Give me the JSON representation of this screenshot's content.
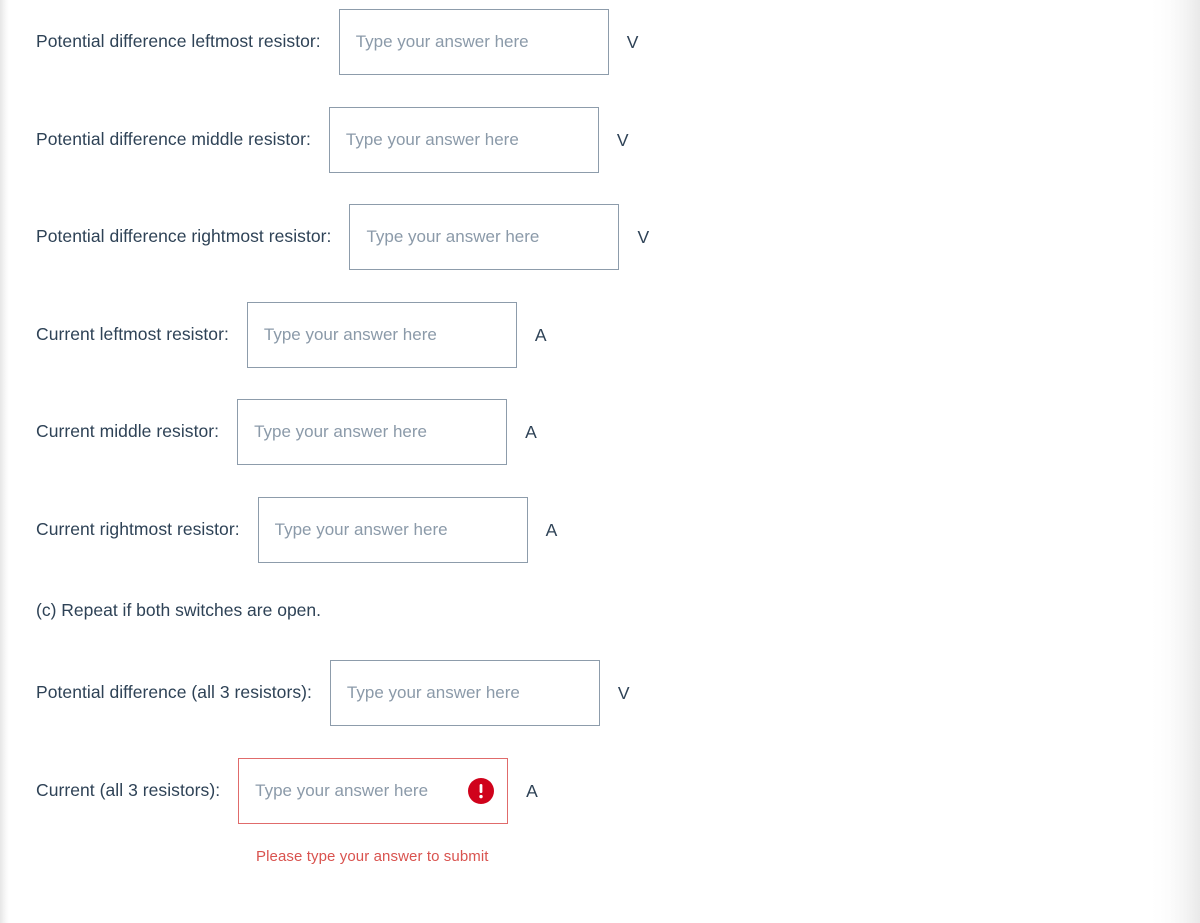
{
  "placeholder_text": "Type your answer here",
  "colors": {
    "label_text": "#2e4256",
    "placeholder": "#8b9aa9",
    "input_border": "#8d9cab",
    "error_border": "#e06b6b",
    "error_icon_fill": "#d0021b",
    "error_text": "#d9534f",
    "background": "#ffffff"
  },
  "section_note": "(c) Repeat if both switches are open.",
  "rows": [
    {
      "label": "Potential difference leftmost resistor:",
      "value": "",
      "placeholder": "Type your answer here",
      "unit": "V",
      "error": false
    },
    {
      "label": "Potential difference middle resistor:",
      "value": "",
      "placeholder": "Type your answer here",
      "unit": "V",
      "error": false
    },
    {
      "label": "Potential difference rightmost resistor:",
      "value": "",
      "placeholder": "Type your answer here",
      "unit": "V",
      "error": false
    },
    {
      "label": "Current leftmost resistor:",
      "value": "",
      "placeholder": "Type your answer here",
      "unit": "A",
      "error": false
    },
    {
      "label": "Current middle resistor:",
      "value": "",
      "placeholder": "Type your answer here",
      "unit": "A",
      "error": false
    },
    {
      "label": "Current rightmost resistor:",
      "value": "",
      "placeholder": "Type your answer here",
      "unit": "A",
      "error": false
    },
    {
      "label": "Potential difference (all 3 resistors):",
      "value": "",
      "placeholder": "Type your answer here",
      "unit": "V",
      "error": false
    },
    {
      "label": "Current (all 3 resistors):",
      "value": "",
      "placeholder": "Type your answer here",
      "unit": "A",
      "error": true,
      "error_message": "Please type your answer to submit",
      "error_icon": "exclamation-circle-icon"
    }
  ]
}
